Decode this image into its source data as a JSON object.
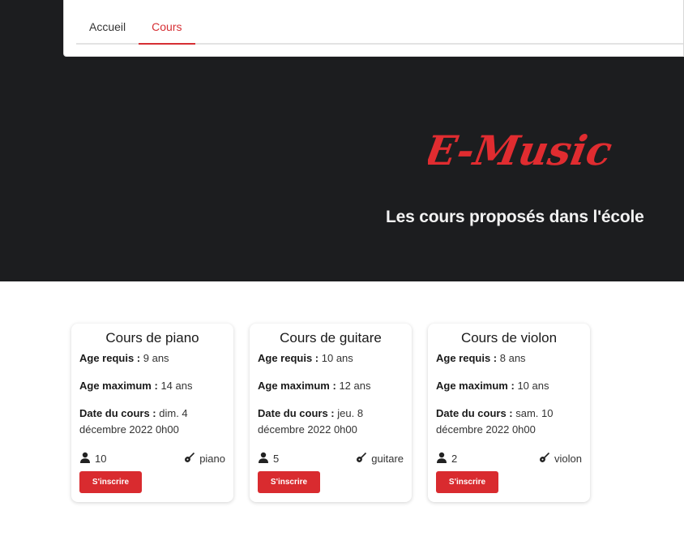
{
  "nav": {
    "tabs": [
      {
        "label": "Accueil",
        "active": false
      },
      {
        "label": "Cours",
        "active": true
      }
    ]
  },
  "hero": {
    "logo_text": "E-Music",
    "subtitle": "Les cours proposés dans l'école"
  },
  "colors": {
    "accent": "#d92b2f",
    "hero_bg": "#1c1d1f"
  },
  "courses": [
    {
      "title": "Cours de piano",
      "age_required_label": "Age requis :",
      "age_required": "9 ans",
      "age_max_label": "Age maximum :",
      "age_max": "14 ans",
      "date_label": "Date du cours :",
      "date": "dim. 4 décembre 2022 0h00",
      "participants": "10",
      "instrument": "piano",
      "button": "S'inscrire"
    },
    {
      "title": "Cours de guitare",
      "age_required_label": "Age requis :",
      "age_required": "10 ans",
      "age_max_label": "Age maximum :",
      "age_max": "12 ans",
      "date_label": "Date du cours :",
      "date": "jeu. 8 décembre 2022 0h00",
      "participants": "5",
      "instrument": "guitare",
      "button": "S'inscrire"
    },
    {
      "title": "Cours de violon",
      "age_required_label": "Age requis :",
      "age_required": "8 ans",
      "age_max_label": "Age maximum :",
      "age_max": "10 ans",
      "date_label": "Date du cours :",
      "date": "sam. 10 décembre 2022 0h00",
      "participants": "2",
      "instrument": "violon",
      "button": "S'inscrire"
    }
  ]
}
